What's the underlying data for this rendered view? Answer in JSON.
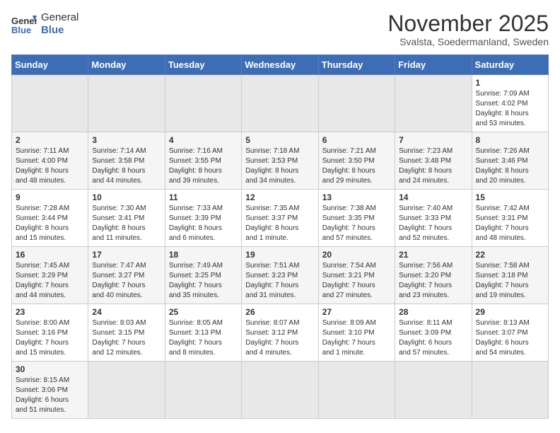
{
  "header": {
    "logo_general": "General",
    "logo_blue": "Blue",
    "title": "November 2025",
    "subtitle": "Svalsta, Soedermanland, Sweden"
  },
  "weekdays": [
    "Sunday",
    "Monday",
    "Tuesday",
    "Wednesday",
    "Thursday",
    "Friday",
    "Saturday"
  ],
  "weeks": [
    [
      {
        "day": "",
        "info": ""
      },
      {
        "day": "",
        "info": ""
      },
      {
        "day": "",
        "info": ""
      },
      {
        "day": "",
        "info": ""
      },
      {
        "day": "",
        "info": ""
      },
      {
        "day": "",
        "info": ""
      },
      {
        "day": "1",
        "info": "Sunrise: 7:09 AM\nSunset: 4:02 PM\nDaylight: 8 hours\nand 53 minutes."
      }
    ],
    [
      {
        "day": "2",
        "info": "Sunrise: 7:11 AM\nSunset: 4:00 PM\nDaylight: 8 hours\nand 48 minutes."
      },
      {
        "day": "3",
        "info": "Sunrise: 7:14 AM\nSunset: 3:58 PM\nDaylight: 8 hours\nand 44 minutes."
      },
      {
        "day": "4",
        "info": "Sunrise: 7:16 AM\nSunset: 3:55 PM\nDaylight: 8 hours\nand 39 minutes."
      },
      {
        "day": "5",
        "info": "Sunrise: 7:18 AM\nSunset: 3:53 PM\nDaylight: 8 hours\nand 34 minutes."
      },
      {
        "day": "6",
        "info": "Sunrise: 7:21 AM\nSunset: 3:50 PM\nDaylight: 8 hours\nand 29 minutes."
      },
      {
        "day": "7",
        "info": "Sunrise: 7:23 AM\nSunset: 3:48 PM\nDaylight: 8 hours\nand 24 minutes."
      },
      {
        "day": "8",
        "info": "Sunrise: 7:26 AM\nSunset: 3:46 PM\nDaylight: 8 hours\nand 20 minutes."
      }
    ],
    [
      {
        "day": "9",
        "info": "Sunrise: 7:28 AM\nSunset: 3:44 PM\nDaylight: 8 hours\nand 15 minutes."
      },
      {
        "day": "10",
        "info": "Sunrise: 7:30 AM\nSunset: 3:41 PM\nDaylight: 8 hours\nand 11 minutes."
      },
      {
        "day": "11",
        "info": "Sunrise: 7:33 AM\nSunset: 3:39 PM\nDaylight: 8 hours\nand 6 minutes."
      },
      {
        "day": "12",
        "info": "Sunrise: 7:35 AM\nSunset: 3:37 PM\nDaylight: 8 hours\nand 1 minute."
      },
      {
        "day": "13",
        "info": "Sunrise: 7:38 AM\nSunset: 3:35 PM\nDaylight: 7 hours\nand 57 minutes."
      },
      {
        "day": "14",
        "info": "Sunrise: 7:40 AM\nSunset: 3:33 PM\nDaylight: 7 hours\nand 52 minutes."
      },
      {
        "day": "15",
        "info": "Sunrise: 7:42 AM\nSunset: 3:31 PM\nDaylight: 7 hours\nand 48 minutes."
      }
    ],
    [
      {
        "day": "16",
        "info": "Sunrise: 7:45 AM\nSunset: 3:29 PM\nDaylight: 7 hours\nand 44 minutes."
      },
      {
        "day": "17",
        "info": "Sunrise: 7:47 AM\nSunset: 3:27 PM\nDaylight: 7 hours\nand 40 minutes."
      },
      {
        "day": "18",
        "info": "Sunrise: 7:49 AM\nSunset: 3:25 PM\nDaylight: 7 hours\nand 35 minutes."
      },
      {
        "day": "19",
        "info": "Sunrise: 7:51 AM\nSunset: 3:23 PM\nDaylight: 7 hours\nand 31 minutes."
      },
      {
        "day": "20",
        "info": "Sunrise: 7:54 AM\nSunset: 3:21 PM\nDaylight: 7 hours\nand 27 minutes."
      },
      {
        "day": "21",
        "info": "Sunrise: 7:56 AM\nSunset: 3:20 PM\nDaylight: 7 hours\nand 23 minutes."
      },
      {
        "day": "22",
        "info": "Sunrise: 7:58 AM\nSunset: 3:18 PM\nDaylight: 7 hours\nand 19 minutes."
      }
    ],
    [
      {
        "day": "23",
        "info": "Sunrise: 8:00 AM\nSunset: 3:16 PM\nDaylight: 7 hours\nand 15 minutes."
      },
      {
        "day": "24",
        "info": "Sunrise: 8:03 AM\nSunset: 3:15 PM\nDaylight: 7 hours\nand 12 minutes."
      },
      {
        "day": "25",
        "info": "Sunrise: 8:05 AM\nSunset: 3:13 PM\nDaylight: 7 hours\nand 8 minutes."
      },
      {
        "day": "26",
        "info": "Sunrise: 8:07 AM\nSunset: 3:12 PM\nDaylight: 7 hours\nand 4 minutes."
      },
      {
        "day": "27",
        "info": "Sunrise: 8:09 AM\nSunset: 3:10 PM\nDaylight: 7 hours\nand 1 minute."
      },
      {
        "day": "28",
        "info": "Sunrise: 8:11 AM\nSunset: 3:09 PM\nDaylight: 6 hours\nand 57 minutes."
      },
      {
        "day": "29",
        "info": "Sunrise: 8:13 AM\nSunset: 3:07 PM\nDaylight: 6 hours\nand 54 minutes."
      }
    ],
    [
      {
        "day": "30",
        "info": "Sunrise: 8:15 AM\nSunset: 3:06 PM\nDaylight: 6 hours\nand 51 minutes."
      },
      {
        "day": "",
        "info": ""
      },
      {
        "day": "",
        "info": ""
      },
      {
        "day": "",
        "info": ""
      },
      {
        "day": "",
        "info": ""
      },
      {
        "day": "",
        "info": ""
      },
      {
        "day": "",
        "info": ""
      }
    ]
  ]
}
